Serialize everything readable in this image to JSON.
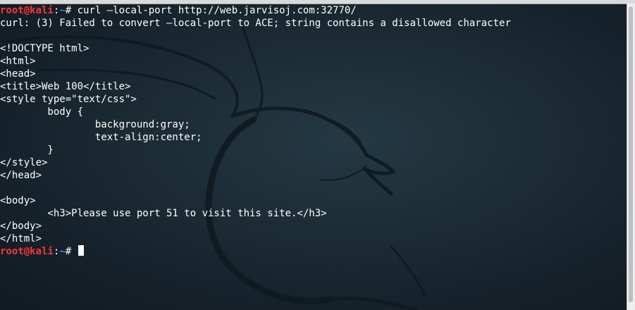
{
  "prompt": {
    "user": "root@kali",
    "separator": ":",
    "path": "~",
    "symbol": "# "
  },
  "lines": [
    {
      "kind": "command",
      "text": "curl —local-port http://web.jarvisoj.com:32770/"
    },
    {
      "kind": "output",
      "text": "curl: (3) Failed to convert —local-port to ACE; string contains a disallowed character"
    },
    {
      "kind": "output",
      "text": ""
    },
    {
      "kind": "output",
      "text": "<!DOCTYPE html>"
    },
    {
      "kind": "output",
      "text": "<html>"
    },
    {
      "kind": "output",
      "text": "<head>"
    },
    {
      "kind": "output",
      "text": "<title>Web 100</title>"
    },
    {
      "kind": "output",
      "text": "<style type=\"text/css\">"
    },
    {
      "kind": "output",
      "text": "        body {"
    },
    {
      "kind": "output",
      "text": "                background:gray;"
    },
    {
      "kind": "output",
      "text": "                text-align:center;"
    },
    {
      "kind": "output",
      "text": "        }"
    },
    {
      "kind": "output",
      "text": "</style>"
    },
    {
      "kind": "output",
      "text": "</head>"
    },
    {
      "kind": "output",
      "text": ""
    },
    {
      "kind": "output",
      "text": "<body>"
    },
    {
      "kind": "output",
      "text": "        <h3>Please use port 51 to visit this site.</h3>"
    },
    {
      "kind": "output",
      "text": "</body>"
    },
    {
      "kind": "output",
      "text": "</html>"
    },
    {
      "kind": "prompt_cursor",
      "text": ""
    }
  ],
  "colors": {
    "background": "#1b2a33",
    "user": "#ff3535",
    "path": "#4f7cff",
    "text": "#ffffff"
  },
  "background_image": "kali-dragon-wallpaper"
}
